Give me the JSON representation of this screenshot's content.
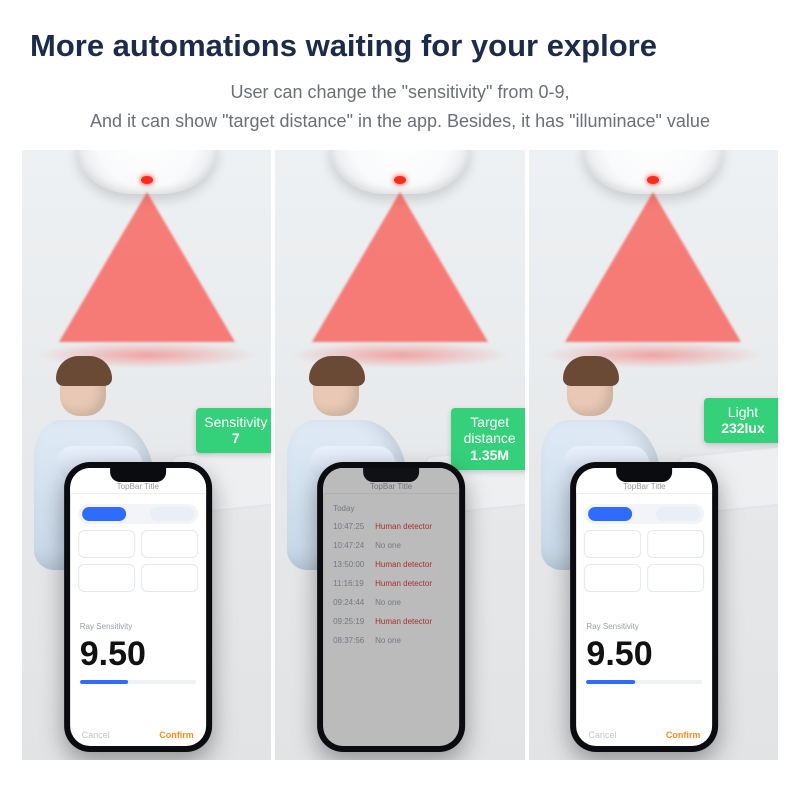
{
  "header": {
    "title": "More automations waiting for your explore",
    "sub_line1_a": "User can change the  ",
    "sub_line1_q1": "\"sensitivity\"",
    "sub_line1_b": "  from 0-9,",
    "sub_line2_a": "And it can show  ",
    "sub_line2_q1": "\"target distance\"",
    "sub_line2_b": "  in the app. Besides, it has  ",
    "sub_line2_q2": "\"illuminace\"",
    "sub_line2_c": "  value"
  },
  "phone_common": {
    "topbar_title": "TopBar Title",
    "section_label": "Ray Sensitivity",
    "footer_cancel": "Cancel",
    "footer_confirm": "Confirm"
  },
  "col1": {
    "callout_line1": "Sensitivity",
    "callout_line2": "7",
    "big_number": "9.50"
  },
  "col2": {
    "callout_line1": "Target",
    "callout_line2": "distance",
    "callout_line3": "1.35M",
    "day_label": "Today",
    "logs": [
      {
        "t": "10:47:25",
        "v": "Human detector",
        "cls": "hd"
      },
      {
        "t": "10:47:24",
        "v": "No one",
        "cls": "no"
      },
      {
        "t": "13:50:00",
        "v": "Human detector",
        "cls": "hd"
      },
      {
        "t": "11:16:19",
        "v": "Human detector",
        "cls": "hd"
      },
      {
        "t": "09:24:44",
        "v": "No one",
        "cls": "no"
      },
      {
        "t": "09:25:19",
        "v": "Human detector",
        "cls": "hd"
      },
      {
        "t": "08:37:56",
        "v": "No one",
        "cls": "no"
      }
    ]
  },
  "col3": {
    "callout_line1": "Light",
    "callout_line2": "232lux",
    "big_number": "9.50"
  }
}
